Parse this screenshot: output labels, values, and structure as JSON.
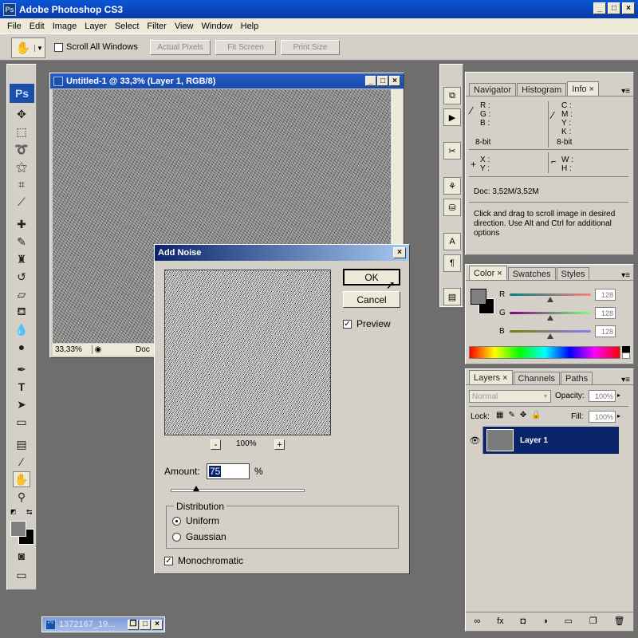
{
  "app": {
    "title": "Adobe Photoshop CS3",
    "icon": "Ps"
  },
  "menu": [
    "File",
    "Edit",
    "Image",
    "Layer",
    "Select",
    "Filter",
    "View",
    "Window",
    "Help"
  ],
  "options": {
    "scroll_all": "Scroll All Windows",
    "actual_pixels": "Actual Pixels",
    "fit_screen": "Fit Screen",
    "print_size": "Print Size"
  },
  "toolbox": {
    "logo": "Ps"
  },
  "document": {
    "title": "Untitled-1 @ 33,3% (Layer 1, RGB/8)",
    "zoom": "33,33%",
    "status": "Doc"
  },
  "minimized": {
    "title": "1372167_19..."
  },
  "info_panel": {
    "tabs": [
      "Navigator",
      "Histogram",
      "Info"
    ],
    "rgb_labels": [
      "R :",
      "G :",
      "B :"
    ],
    "cmyk_labels": [
      "C :",
      "M :",
      "Y :",
      "K :"
    ],
    "bit_left": "8-bit",
    "bit_right": "8-bit",
    "xy_labels": [
      "X :",
      "Y :"
    ],
    "wh_labels": [
      "W :",
      "H :"
    ],
    "doc_size": "Doc: 3,52M/3,52M",
    "hint": "Click and drag to scroll image in desired direction. Use Alt and Ctrl for additional options"
  },
  "color_panel": {
    "tabs": [
      "Color",
      "Swatches",
      "Styles"
    ],
    "r_label": "R",
    "g_label": "G",
    "b_label": "B",
    "r": "128",
    "g": "128",
    "b": "128"
  },
  "layers_panel": {
    "tabs": [
      "Layers",
      "Channels",
      "Paths"
    ],
    "blend_mode": "Normal",
    "opacity_label": "Opacity:",
    "opacity": "100%",
    "lock_label": "Lock:",
    "fill_label": "Fill:",
    "fill": "100%",
    "layer_name": "Layer 1"
  },
  "dialog": {
    "title": "Add Noise",
    "ok": "OK",
    "cancel": "Cancel",
    "preview": "Preview",
    "zoom": "100%",
    "minus": "-",
    "plus": "+",
    "amount_label": "Amount:",
    "amount": "75",
    "amount_unit": "%",
    "amount_level": 0.19,
    "distribution_label": "Distribution",
    "uniform": "Uniform",
    "gaussian": "Gaussian",
    "monochromatic": "Monochromatic"
  },
  "colors": {
    "title_blue": "#0a3aa8",
    "selected_layer": "#0a246a"
  }
}
